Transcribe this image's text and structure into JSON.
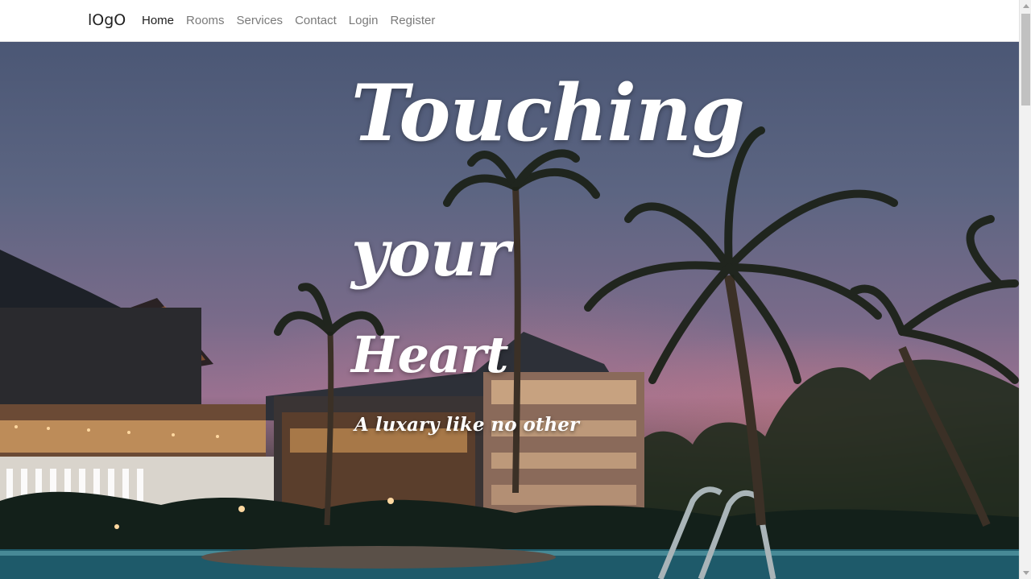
{
  "brand": {
    "logo_text": "lOgO"
  },
  "nav": {
    "items": [
      {
        "label": "Home",
        "active": true
      },
      {
        "label": "Rooms",
        "active": false
      },
      {
        "label": "Services",
        "active": false
      },
      {
        "label": "Contact",
        "active": false
      },
      {
        "label": "Login",
        "active": false
      },
      {
        "label": "Register",
        "active": false
      }
    ]
  },
  "hero": {
    "headline_line1": "Touching",
    "headline_line2": "your",
    "headline_line3": "Heart",
    "tagline": "A luxary like no other",
    "background_description_icon": "resort-pool-palms-image"
  },
  "colors": {
    "nav_active": "#1f1f1f",
    "nav_inactive": "#7a7a7a",
    "headline": "#ffffff"
  }
}
